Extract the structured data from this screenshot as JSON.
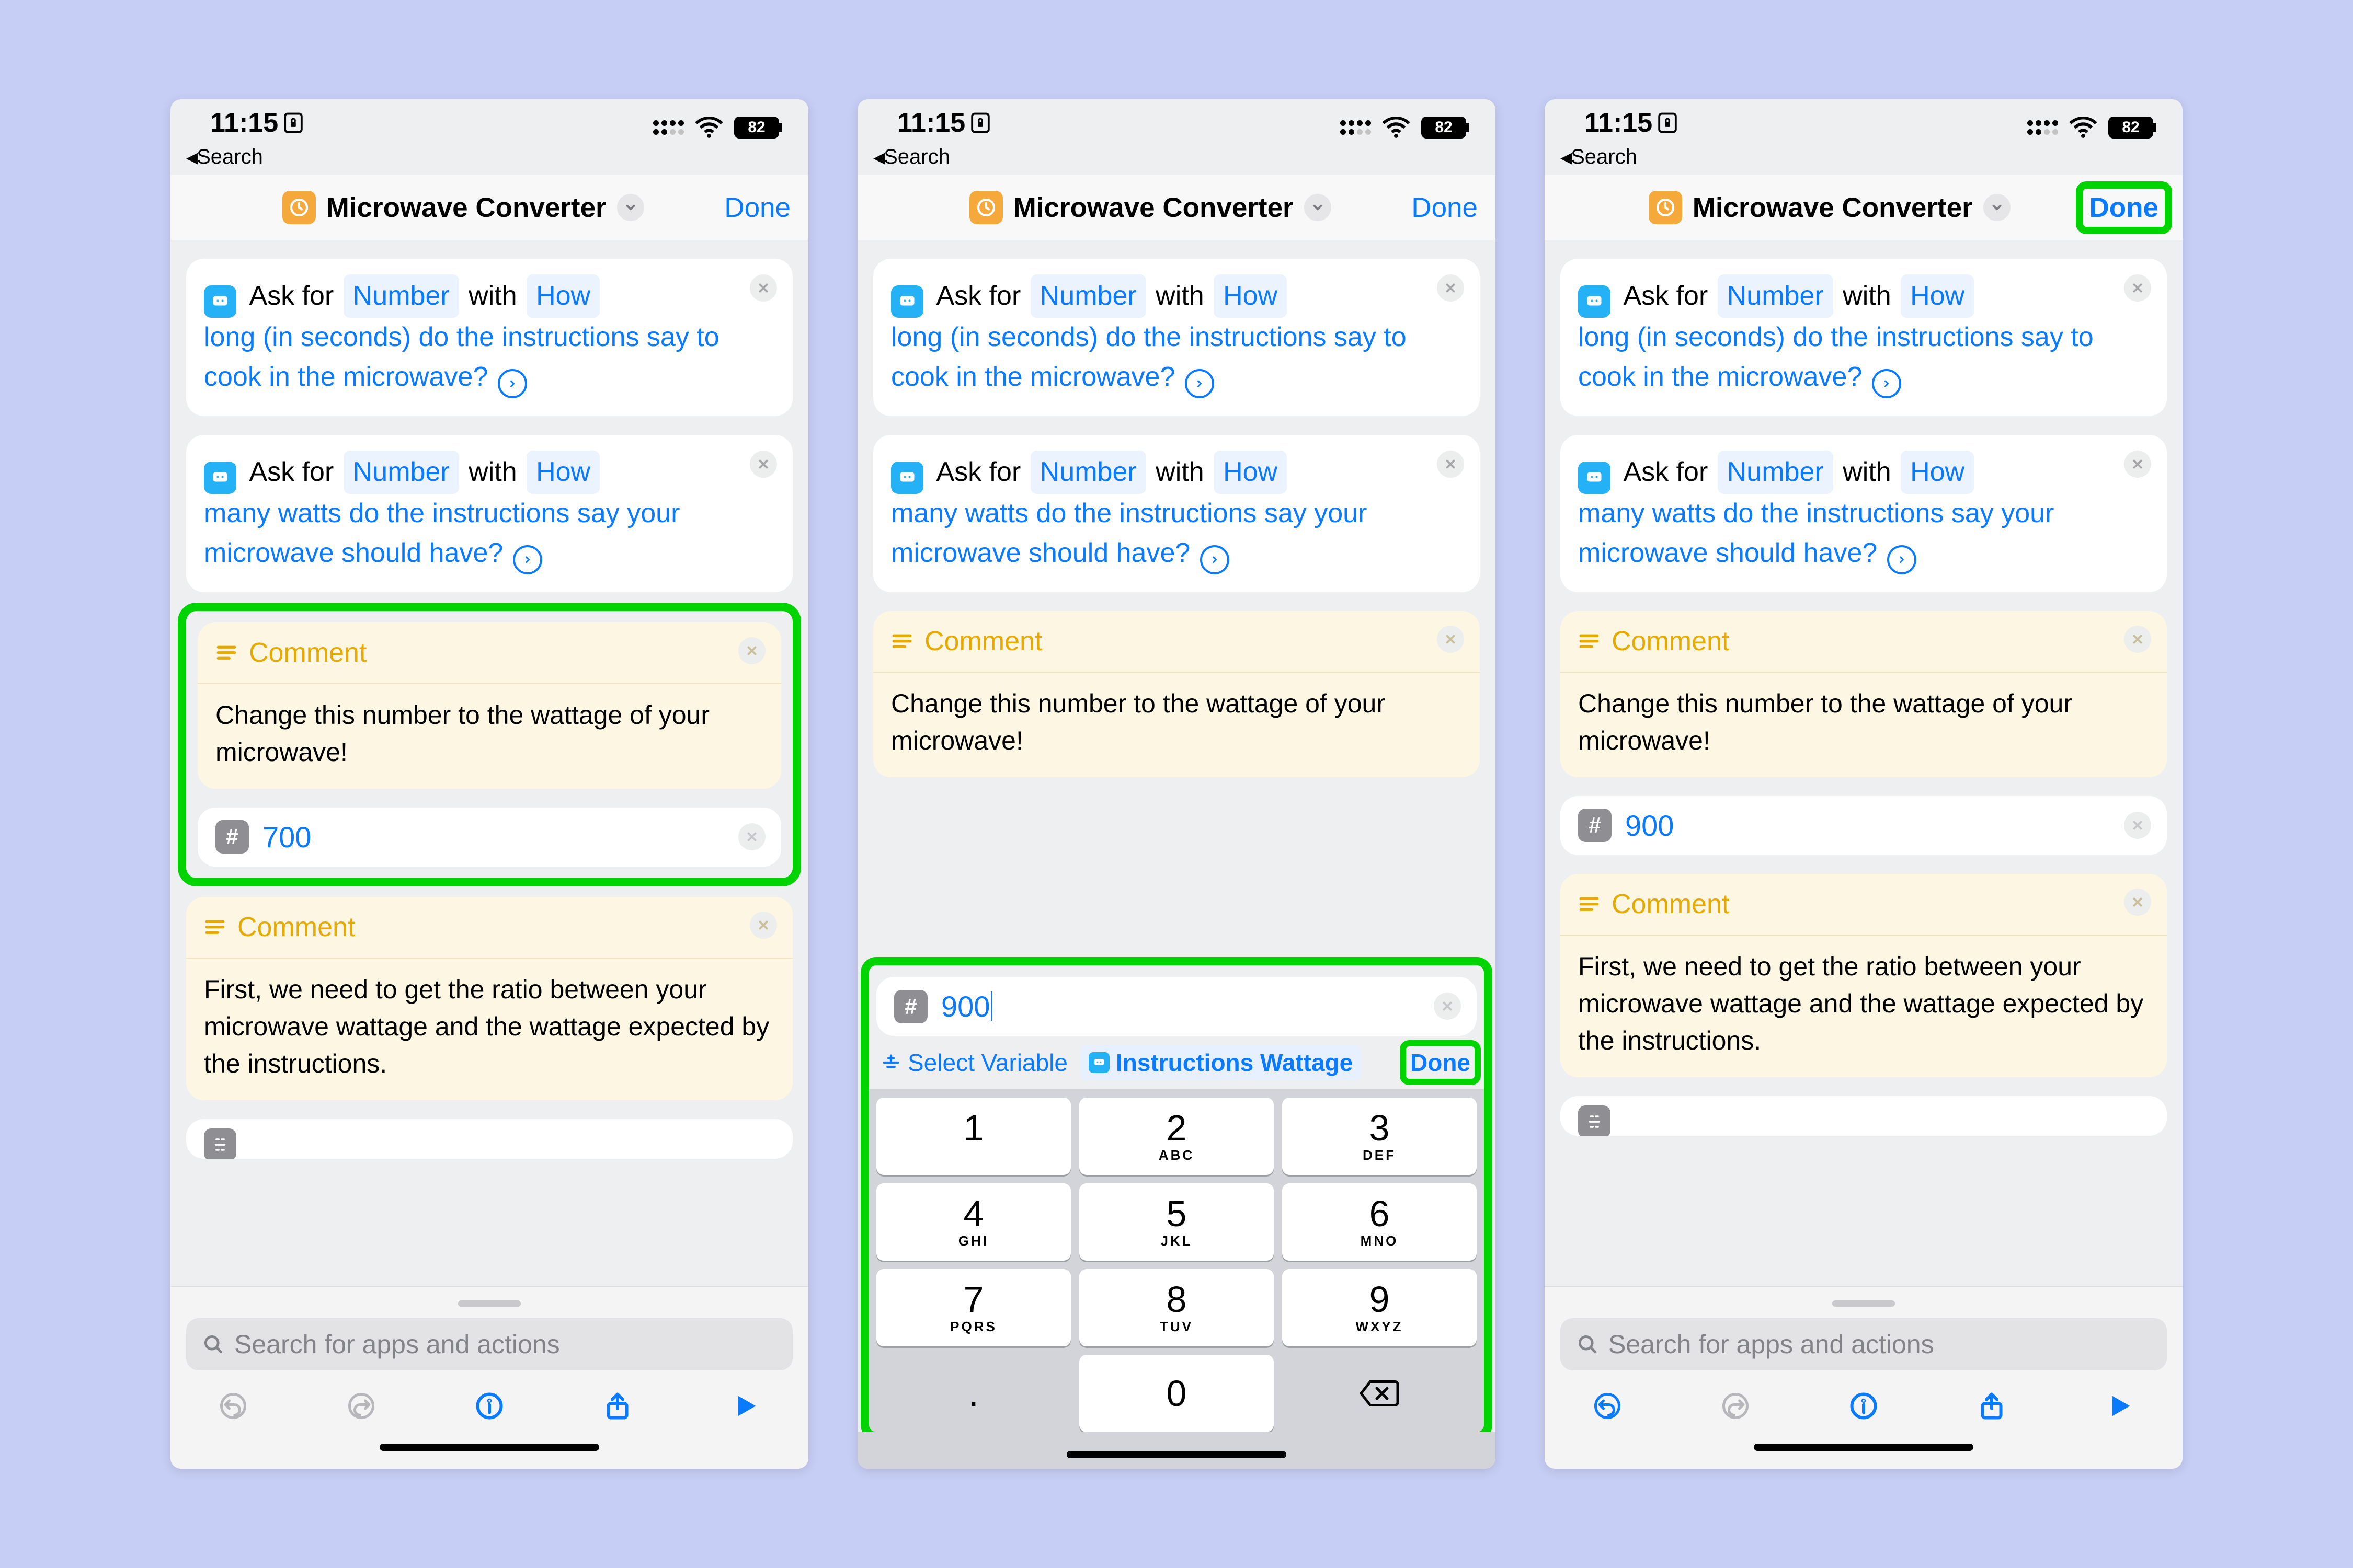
{
  "status": {
    "time": "11:15",
    "battery": "82"
  },
  "back": {
    "label": "Search"
  },
  "nav": {
    "title": "Microwave Converter",
    "done": "Done"
  },
  "ask1": {
    "prefix": "Ask for",
    "token": "Number",
    "with": "with",
    "lead": "How",
    "rest": "long (in seconds) do the instructions say to cook in the microwave?"
  },
  "ask2": {
    "prefix": "Ask for",
    "token": "Number",
    "with": "with",
    "lead": "How",
    "rest": "many watts do the instructions say your microwave should have?"
  },
  "comment1": {
    "title": "Comment",
    "body": "Change this number to the wattage of your microwave!"
  },
  "number": {
    "val_a": "700",
    "val_b": "900",
    "val_c": "900"
  },
  "comment2": {
    "title": "Comment",
    "body": "First, we need to get the ratio between your microwave wattage and the wattage expected by the instructions."
  },
  "search": {
    "placeholder": "Search for apps and actions"
  },
  "kbacc": {
    "select": "Select Variable",
    "var": "Instructions Wattage",
    "done": "Done"
  },
  "keys": {
    "k1": "1",
    "k2": "2",
    "k3": "3",
    "k4": "4",
    "k5": "5",
    "k6": "6",
    "k7": "7",
    "k8": "8",
    "k9": "9",
    "k0": "0",
    "l2": "ABC",
    "l3": "DEF",
    "l4": "GHI",
    "l5": "JKL",
    "l6": "MNO",
    "l7": "PQRS",
    "l8": "TUV",
    "l9": "WXYZ",
    "dot": "."
  }
}
